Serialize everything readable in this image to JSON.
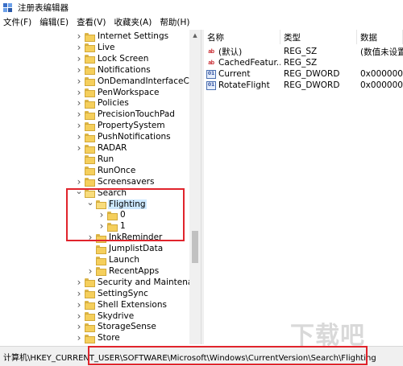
{
  "window": {
    "title": "注册表编辑器"
  },
  "menu": [
    "文件(F)",
    "编辑(E)",
    "查看(V)",
    "收藏夹(A)",
    "帮助(H)"
  ],
  "tree": [
    {
      "label": "Internet Settings",
      "expander": ">",
      "level": 0
    },
    {
      "label": "Live",
      "expander": ">",
      "level": 0
    },
    {
      "label": "Lock Screen",
      "expander": ">",
      "level": 0
    },
    {
      "label": "Notifications",
      "expander": ">",
      "level": 0
    },
    {
      "label": "OnDemandInterfaceCach",
      "expander": ">",
      "level": 0
    },
    {
      "label": "PenWorkspace",
      "expander": ">",
      "level": 0
    },
    {
      "label": "Policies",
      "expander": ">",
      "level": 0
    },
    {
      "label": "PrecisionTouchPad",
      "expander": ">",
      "level": 0
    },
    {
      "label": "PropertySystem",
      "expander": ">",
      "level": 0
    },
    {
      "label": "PushNotifications",
      "expander": ">",
      "level": 0
    },
    {
      "label": "RADAR",
      "expander": ">",
      "level": 0
    },
    {
      "label": "Run",
      "expander": "",
      "level": 0
    },
    {
      "label": "RunOnce",
      "expander": "",
      "level": 0
    },
    {
      "label": "Screensavers",
      "expander": ">",
      "level": 0
    },
    {
      "label": "Search",
      "expander": "v",
      "level": 0,
      "open": true
    },
    {
      "label": "Flighting",
      "expander": "v",
      "level": 1,
      "open": true,
      "selected": true
    },
    {
      "label": "0",
      "expander": ">",
      "level": 2
    },
    {
      "label": "1",
      "expander": ">",
      "level": 2
    },
    {
      "label": "InkReminder",
      "expander": ">",
      "level": 1
    },
    {
      "label": "JumplistData",
      "expander": "",
      "level": 1
    },
    {
      "label": "Launch",
      "expander": "",
      "level": 1
    },
    {
      "label": "RecentApps",
      "expander": ">",
      "level": 1
    },
    {
      "label": "Security and Maintenanc",
      "expander": ">",
      "level": 0
    },
    {
      "label": "SettingSync",
      "expander": ">",
      "level": 0
    },
    {
      "label": "Shell Extensions",
      "expander": ">",
      "level": 0
    },
    {
      "label": "Skydrive",
      "expander": ">",
      "level": 0
    },
    {
      "label": "StorageSense",
      "expander": ">",
      "level": 0
    },
    {
      "label": "Store",
      "expander": ">",
      "level": 0
    }
  ],
  "values_table": {
    "headers": {
      "name": "名称",
      "type": "类型",
      "data": "数据"
    },
    "rows": [
      {
        "icon": "string-value-icon",
        "name": "(默认)",
        "type": "REG_SZ",
        "data": "(数值未设置)"
      },
      {
        "icon": "string-value-icon",
        "name": "CachedFeatur...",
        "type": "REG_SZ",
        "data": ""
      },
      {
        "icon": "dword-value-icon",
        "name": "Current",
        "type": "REG_DWORD",
        "data": "0x00000001"
      },
      {
        "icon": "dword-value-icon",
        "name": "RotateFlight",
        "type": "REG_DWORD",
        "data": "0x00000000"
      }
    ]
  },
  "statusbar": {
    "path": "计算机\\HKEY_CURRENT_USER\\SOFTWARE\\Microsoft\\Windows\\CurrentVersion\\Search\\Flighting"
  },
  "colors": {
    "highlight": "#e0242c",
    "selection": "#cce8ff",
    "folder": "#f5cf5c"
  },
  "watermark": "下载吧"
}
